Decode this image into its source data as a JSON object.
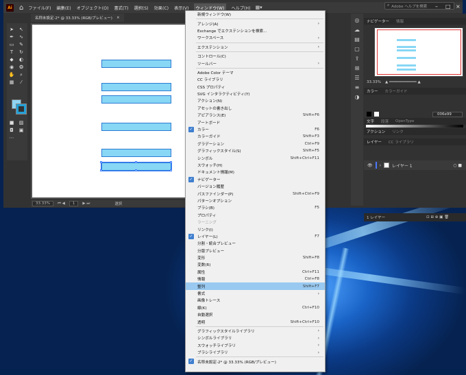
{
  "menubar": {
    "logo": "Ai",
    "items": [
      "ファイル(F)",
      "編集(E)",
      "オブジェクト(O)",
      "書式(T)",
      "選択(S)",
      "効果(C)",
      "表示(V)",
      "ウィンドウ(W)",
      "ヘルプ(H)"
    ],
    "active_index": 7,
    "search_placeholder": "Adobe ヘルプを検索"
  },
  "document": {
    "tab_label": "名称未設定-2* @ 33.33% (RGB/プレビュー)",
    "close": "×"
  },
  "statusbar": {
    "zoom": "33.33%",
    "artboard": "1",
    "mode": "選択"
  },
  "panels": {
    "navigator_tabs": [
      "ナビゲーター",
      "情報"
    ],
    "zoom": "33.33%",
    "color_tabs": [
      "カラー",
      "カラーガイド"
    ],
    "hex_value": "006e99",
    "type_tabs": [
      "文字",
      "段落",
      "OpenType"
    ],
    "action_tabs": [
      "アクション",
      "リンク"
    ],
    "layer_tabs": [
      "レイヤー",
      "CC ライブラリ"
    ],
    "layer_name": "レイヤー 1",
    "layer_count": "1 レイヤー"
  },
  "colors": {
    "fill": "#8fd4f2",
    "stroke": "#23a0d6",
    "rect_fill": "#87d7f5",
    "rect_stroke": "#2a7ad2",
    "menu_highlight": "#99c9f0",
    "checkmark": "#3f7fcf"
  },
  "window_menu": {
    "items": [
      {
        "label": "新規ウィンドウ(W)"
      },
      {
        "sep": true
      },
      {
        "label": "アレンジ(A)",
        "submenu": true
      },
      {
        "label": "Exchange でエクステンションを検索..."
      },
      {
        "label": "ワークスペース",
        "submenu": true
      },
      {
        "sep": true
      },
      {
        "label": "エクステンション",
        "submenu": true
      },
      {
        "sep": true
      },
      {
        "label": "コントロール(C)"
      },
      {
        "label": "ツールバー",
        "submenu": true
      },
      {
        "sep": true
      },
      {
        "label": "Adobe Color テーマ"
      },
      {
        "label": "CC ライブラリ"
      },
      {
        "label": "CSS プロパティ"
      },
      {
        "label": "SVG インタラクティビティ(Y)"
      },
      {
        "label": "アクション(N)"
      },
      {
        "label": "アセットの書き出し"
      },
      {
        "label": "アピアランス(E)",
        "shortcut": "Shift+F6"
      },
      {
        "label": "アートボード"
      },
      {
        "label": "カラー",
        "shortcut": "F6",
        "checked": true
      },
      {
        "label": "カラーガイド",
        "shortcut": "Shift+F3"
      },
      {
        "label": "グラデーション",
        "shortcut": "Ctrl+F9"
      },
      {
        "label": "グラフィックスタイル(S)",
        "shortcut": "Shift+F5"
      },
      {
        "label": "シンボル",
        "shortcut": "Shift+Ctrl+F11"
      },
      {
        "label": "スウォッチ(H)"
      },
      {
        "label": "ドキュメント情報(M)"
      },
      {
        "label": "ナビゲーター",
        "checked": true
      },
      {
        "label": "バージョン履歴"
      },
      {
        "label": "パスファインダー(P)",
        "shortcut": "Shift+Ctrl+F9"
      },
      {
        "label": "パターンオプション"
      },
      {
        "label": "ブラシ(B)",
        "shortcut": "F5"
      },
      {
        "label": "プロパティ"
      },
      {
        "label": "ラーニング",
        "disabled": true
      },
      {
        "label": "リンク(I)"
      },
      {
        "label": "レイヤー(L)",
        "shortcut": "F7",
        "checked": true
      },
      {
        "label": "分割・統合プレビュー"
      },
      {
        "label": "分版プレビュー"
      },
      {
        "label": "変形",
        "shortcut": "Shift+F8"
      },
      {
        "label": "変数(R)"
      },
      {
        "label": "属性",
        "shortcut": "Ctrl+F11"
      },
      {
        "label": "情報",
        "shortcut": "Ctrl+F8"
      },
      {
        "label": "整列",
        "shortcut": "Shift+F7",
        "highlight": true
      },
      {
        "label": "書式",
        "submenu": true
      },
      {
        "label": "画像トレース"
      },
      {
        "label": "線(K)",
        "shortcut": "Ctrl+F10"
      },
      {
        "label": "自動選択"
      },
      {
        "label": "透明",
        "shortcut": "Shift+Ctrl+F10"
      },
      {
        "sep": true
      },
      {
        "label": "グラフィックスタイルライブラリ",
        "submenu": true
      },
      {
        "label": "シンボルライブラリ",
        "submenu": true
      },
      {
        "label": "スウォッチライブラリ",
        "submenu": true
      },
      {
        "label": "ブラシライブラリ",
        "submenu": true
      },
      {
        "sep": true
      },
      {
        "label": "名称未設定-2* @ 33.33% (RGB/プレビュー)",
        "checked": true
      }
    ]
  }
}
